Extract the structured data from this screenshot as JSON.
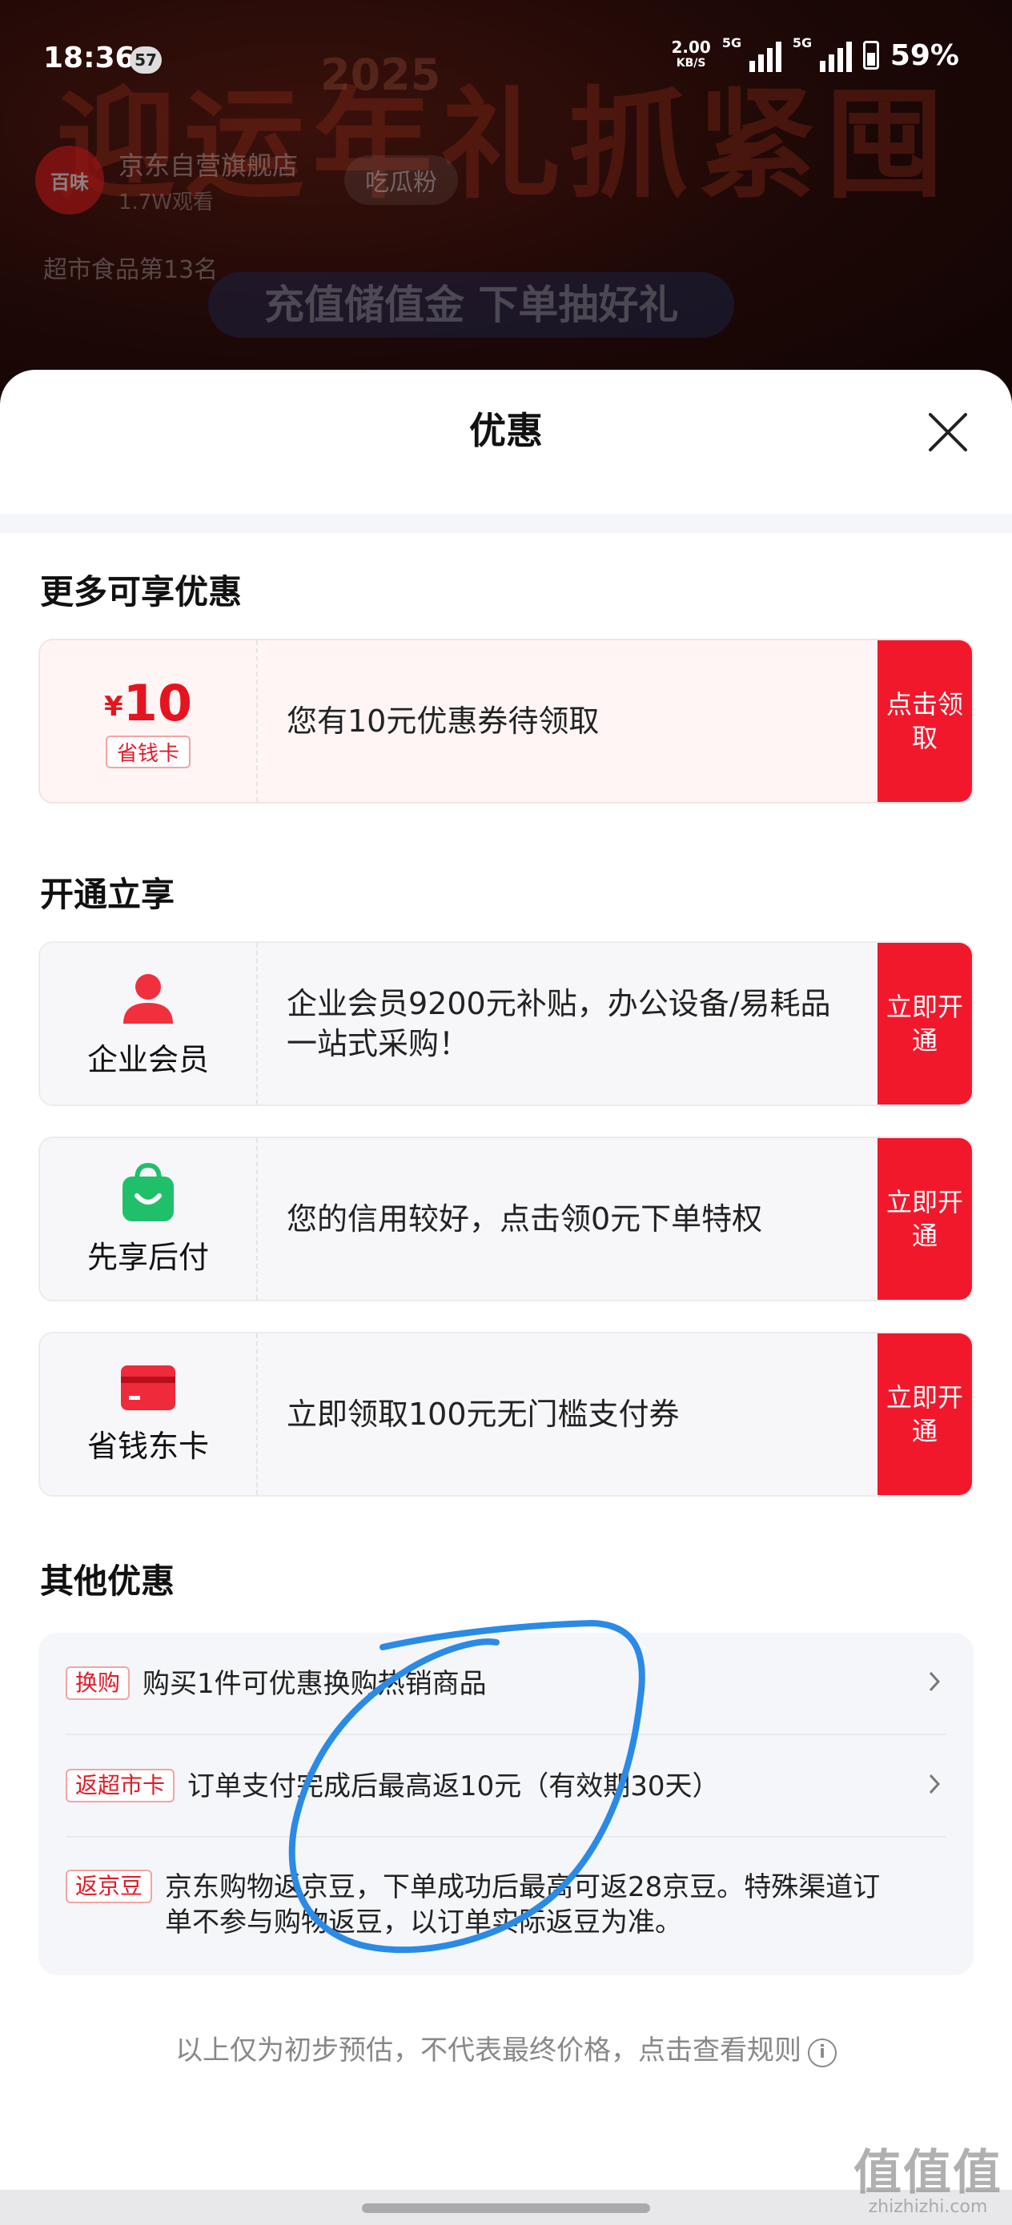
{
  "status_bar": {
    "time": "18:36",
    "notification_count": "57",
    "net_speed_value": "2.00",
    "net_speed_unit": "KB/S",
    "sim1_label": "5G",
    "sim2_label": "5G",
    "battery": "59%"
  },
  "background": {
    "banner_text": "迎运年礼抓紧囤",
    "banner_year": "2025",
    "store_logo_text": "百味",
    "store_name": "京东自营旗舰店",
    "store_views": "1.7W观看",
    "fan_chip": "吃瓜粉",
    "rank": "超市食品第13名",
    "promo": "充值储值金 下单抽好礼"
  },
  "sheet": {
    "title": "优惠"
  },
  "sections": {
    "more": "更多可享优惠",
    "open": "开通立享",
    "other": "其他优惠"
  },
  "coupon_card": {
    "currency": "¥",
    "amount": "10",
    "tag": "省钱卡",
    "text": "您有10元优惠券待领取",
    "button": "点击领取"
  },
  "open_cards": [
    {
      "label": "企业会员",
      "icon": "person-icon",
      "text": "企业会员9200元补贴，办公设备/易耗品一站式采购！",
      "button": "立即开通"
    },
    {
      "label": "先享后付",
      "icon": "shopping-bag-icon",
      "text": "您的信用较好，点击领0元下单特权",
      "button": "立即开通"
    },
    {
      "label": "省钱东卡",
      "icon": "card-icon",
      "text": "立即领取100元无门槛支付券",
      "button": "立即开通"
    }
  ],
  "other_offers": [
    {
      "tag": "换购",
      "text": "购买1件可优惠换购热销商品"
    },
    {
      "tag": "返超市卡",
      "text": "订单支付完成后最高返10元（有效期30天）"
    },
    {
      "tag": "返京豆",
      "text": "京东购物返京豆，下单成功后最高可返28京豆。特殊渠道订单不参与购物返豆，以订单实际返豆为准。"
    }
  ],
  "footer_note": "以上仅为初步预估，不代表最终价格，点击查看规则",
  "watermark": {
    "big": "值值值",
    "small": "zhizhizhi.com"
  },
  "colors": {
    "accent_red": "#f2182c",
    "tag_red": "#e01c28",
    "pay_green": "#20c06a",
    "annotation_blue": "#2a8ae6"
  }
}
